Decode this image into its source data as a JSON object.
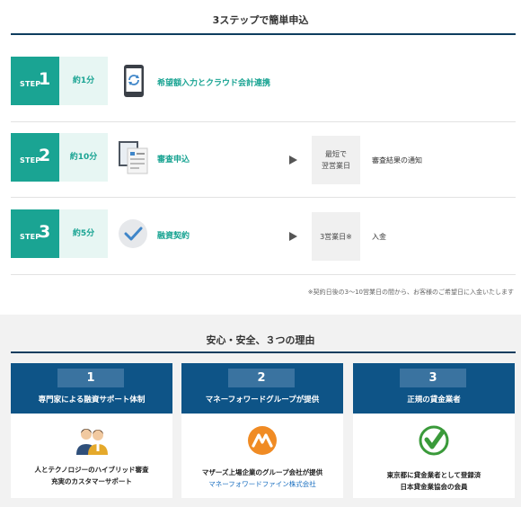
{
  "steps_section": {
    "title": "3ステップで簡単申込",
    "steps": [
      {
        "word": "STEP",
        "number": "1",
        "time": "約1分",
        "label": "希望額入力とクラウド会計連携",
        "icon": "phone-sync-icon"
      },
      {
        "word": "STEP",
        "number": "2",
        "time": "約10分",
        "label": "審査申込",
        "icon": "document-form-icon",
        "result_box": "最短で\n翌営業日",
        "result_text": "審査結果の通知"
      },
      {
        "word": "STEP",
        "number": "3",
        "time": "約5分",
        "label": "融資契約",
        "icon": "checkmark-circle-icon",
        "result_box": "3営業日※",
        "result_text": "入金"
      }
    ],
    "note": "※契約日後の3〜10営業日の間から、お客様のご希望日に入金いたします"
  },
  "reasons_section": {
    "title": "安心・安全、３つの理由",
    "cards": [
      {
        "number": "1",
        "title": "専門家による融資サポート体制",
        "icon": "advisors-icon",
        "lines": [
          "人とテクノロジーのハイブリッド審査",
          "充実のカスタマーサポート"
        ]
      },
      {
        "number": "2",
        "title": "マネーフォワードグループが提供",
        "icon": "moneyforward-logo-icon",
        "lines": [
          "マザーズ上場企業のグループ会社が提供"
        ],
        "link": "マネーフォワードファイン株式会社"
      },
      {
        "number": "3",
        "title": "正規の貸金業者",
        "icon": "green-check-seal-icon",
        "lines": [
          "東京都に貸金業者として登録済",
          "日本貸金業協会の会員"
        ]
      }
    ]
  },
  "colors": {
    "teal": "#1aa493",
    "navy": "#0e5487",
    "rule": "#0e3d5f",
    "link": "#1a6fc0"
  }
}
